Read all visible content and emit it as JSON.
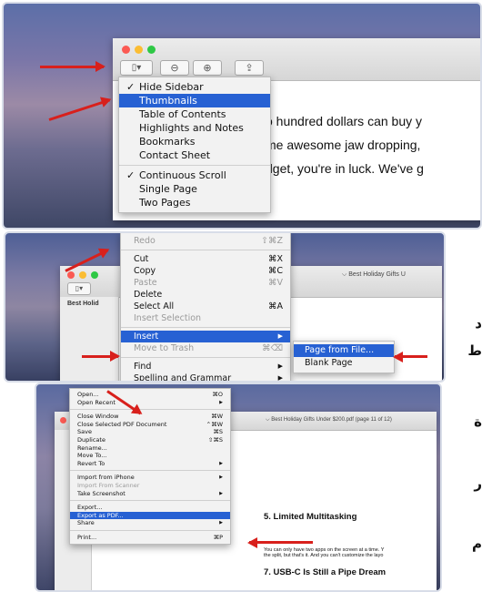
{
  "panel1": {
    "toolbar": {
      "sidebar_icon": "▯▾",
      "zoom_out_icon": "⊖",
      "zoom_in_icon": "⊕",
      "share_icon": "⇪"
    },
    "menu": [
      {
        "label": "Hide Sidebar",
        "checked": true
      },
      {
        "label": "Thumbnails",
        "selected": true
      },
      {
        "label": "Table of Contents"
      },
      {
        "label": "Highlights and Notes"
      },
      {
        "label": "Bookmarks"
      },
      {
        "label": "Contact Sheet"
      },
      {
        "label": "Continuous Scroll",
        "checked": true
      },
      {
        "label": "Single Page"
      },
      {
        "label": "Two Pages"
      }
    ],
    "doc_lines": [
      "o hundred dollars can buy y",
      "me awesome jaw dropping,",
      "dget, you're in luck. We've g"
    ],
    "check_mark": "✓"
  },
  "panel2": {
    "top_item": "Redo",
    "top_shortcut": "⇧⌘Z",
    "menu": [
      {
        "label": "Cut",
        "shortcut": "⌘X"
      },
      {
        "label": "Copy",
        "shortcut": "⌘C"
      },
      {
        "label": "Paste",
        "shortcut": "⌘V",
        "disabled": true
      },
      {
        "label": "Delete"
      },
      {
        "label": "Select All",
        "shortcut": "⌘A"
      },
      {
        "label": "Insert Selection",
        "disabled": true
      },
      {
        "label": "Insert",
        "selected": true,
        "submenu": true
      },
      {
        "label": "Move to Trash",
        "disabled": true,
        "shortcut": "⌘⌫"
      },
      {
        "label": "Find",
        "submenu": true
      },
      {
        "label": "Spelling and Grammar",
        "submenu": true
      }
    ],
    "submenu": [
      {
        "label": "Page from File...",
        "selected": true
      },
      {
        "label": "Blank Page"
      }
    ],
    "window_title": "⌵ Best Holiday Gifts U",
    "sidebar_text": "Best Holid",
    "submenu_arrow": "▶"
  },
  "panel3": {
    "menu": [
      {
        "label": "Open...",
        "shortcut": "⌘O"
      },
      {
        "label": "Open Recent",
        "submenu": true
      },
      {
        "label": "Close Window",
        "shortcut": "⌘W"
      },
      {
        "label": "Close Selected PDF Document",
        "shortcut": "⌃⌘W"
      },
      {
        "label": "Save",
        "shortcut": "⌘S"
      },
      {
        "label": "Duplicate",
        "shortcut": "⇧⌘S"
      },
      {
        "label": "Rename..."
      },
      {
        "label": "Move To..."
      },
      {
        "label": "Revert To",
        "submenu": true
      },
      {
        "label": "Import from iPhone",
        "submenu": true
      },
      {
        "label": "Import From Scanner",
        "disabled": true
      },
      {
        "label": "Take Screenshot",
        "submenu": true
      },
      {
        "label": "Export..."
      },
      {
        "label": "Export as PDF...",
        "selected": true
      },
      {
        "label": "Share",
        "submenu": true
      },
      {
        "label": "Print...",
        "shortcut": "⌘P"
      }
    ],
    "window_title": "⌵ Best Holiday Gifts Under $200.pdf (page 11 of 12)",
    "heading1": "5. Limited Multitasking",
    "body_lines": [
      "You can only have two apps on the screen at a time. Y",
      "the split, but that's it. And you can't customize the layo"
    ],
    "heading2": "7. USB-C Is Still a Pipe Dream"
  },
  "arabic_letters": [
    "د",
    "ط",
    "ة",
    "ر",
    "م"
  ],
  "colors": {
    "arrow": "#d8201c",
    "selection": "#2761d3"
  }
}
